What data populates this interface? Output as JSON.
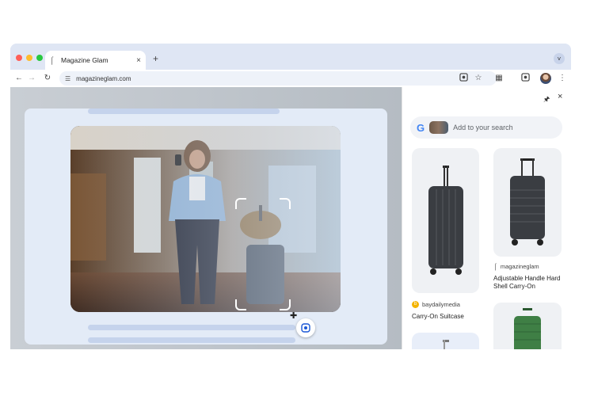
{
  "browser": {
    "tab_title": "Magazine Glam",
    "new_tab_symbol": "+",
    "url": "magazineglam.com",
    "traffic_lights": [
      "#ff5f57",
      "#febc2e",
      "#28c840"
    ]
  },
  "side_panel": {
    "search_placeholder": "Add to your search",
    "google_letter": "G",
    "results": [
      {
        "source": "baydailymedia",
        "title": "Carry-On Suitcase"
      },
      {
        "source": "magazineglam",
        "title": "Adjustable Handle Hard Shell Carry-On"
      }
    ]
  },
  "colors": {
    "accent": "#1a73e8",
    "panel_bg": "#ffffff",
    "page_card": "#e3ebf7",
    "suitcase_dark": "#3a3d42",
    "suitcase_green": "#3f7f45"
  },
  "icons": [
    "back-icon",
    "forward-icon",
    "reload-icon",
    "site-settings-icon",
    "lens-icon",
    "star-icon",
    "extensions-icon",
    "side-panel-lens-icon",
    "more-icon",
    "pin-icon",
    "close-icon"
  ]
}
